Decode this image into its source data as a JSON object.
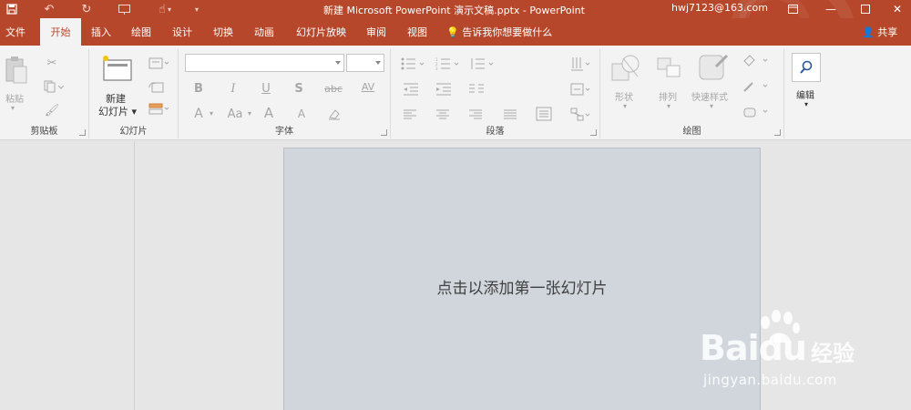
{
  "titlebar": {
    "title": "新建 Microsoft PowerPoint 演示文稿.pptx  -  PowerPoint",
    "account": "hwj7123@163.com"
  },
  "tabs": [
    "文件",
    "开始",
    "插入",
    "绘图",
    "设计",
    "切换",
    "动画",
    "幻灯片放映",
    "审阅",
    "视图"
  ],
  "active_tab": "开始",
  "tell_me": "告诉我你想要做什么",
  "share": "共享",
  "ribbon": {
    "clipboard": {
      "paste": "粘贴",
      "label": "剪贴板"
    },
    "slides": {
      "new_slide_line1": "新建",
      "new_slide_line2": "幻灯片",
      "label": "幻灯片"
    },
    "font": {
      "label": "字体",
      "bold": "B",
      "italic": "I",
      "underline": "U",
      "shadow": "S",
      "strike": "abc",
      "spacing": "AV",
      "font_color": "A",
      "case": "Aa",
      "grow": "A",
      "shrink": "A"
    },
    "paragraph": {
      "label": "段落"
    },
    "drawing": {
      "shapes": "形状",
      "arrange": "排列",
      "quick_styles": "快速样式",
      "label": "绘图"
    },
    "editing": {
      "label": "编辑"
    }
  },
  "slide": {
    "placeholder": "点击以添加第一张幻灯片"
  },
  "watermark": {
    "logo": "Baidu",
    "jingyan": "经验",
    "url": "jingyan.baidu.com"
  }
}
